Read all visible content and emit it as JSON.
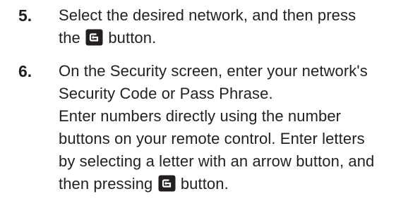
{
  "steps": [
    {
      "number": "5.",
      "line1": "Select the desired network, and then press",
      "line2_before": "the",
      "line2_after": "button.",
      "icon": "enter-icon"
    },
    {
      "number": "6.",
      "line1": "On the Security screen, enter your network's",
      "line2": "Security Code or Pass Phrase.",
      "line3": "Enter numbers directly using the number",
      "line4": "buttons on your remote control. Enter letters",
      "line5": "by selecting a letter with an arrow button, and",
      "line6_before": "then pressing",
      "line6_after": "button.",
      "icon": "enter-icon"
    }
  ],
  "colors": {
    "text": "#231f20",
    "icon_bg": "#231f20",
    "icon_fg": "#ffffff"
  }
}
